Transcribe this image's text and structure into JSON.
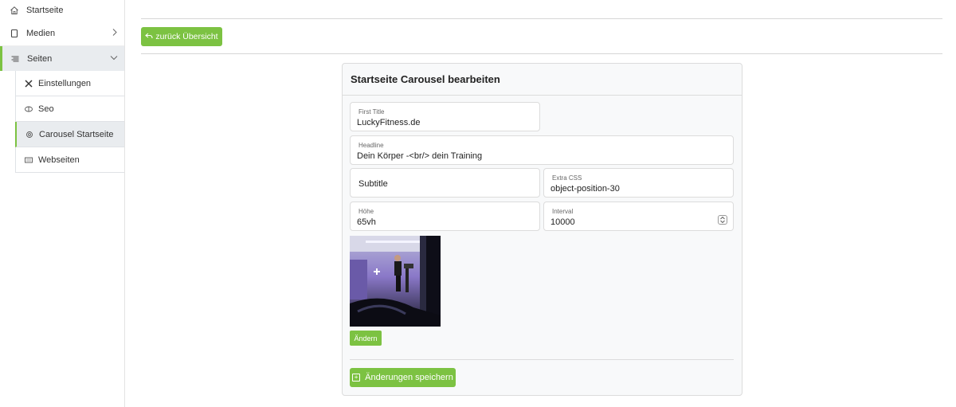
{
  "sidebar": {
    "items": [
      {
        "label": "Startseite",
        "icon": "home-icon"
      },
      {
        "label": "Medien",
        "icon": "file-icon"
      },
      {
        "label": "Seiten",
        "icon": "list-icon"
      }
    ],
    "sub_items": [
      {
        "label": "Einstellungen",
        "icon": "tools-icon"
      },
      {
        "label": "Seo",
        "icon": "seo-icon"
      },
      {
        "label": "Carousel Startseite",
        "icon": "gear-icon"
      },
      {
        "label": "Webseiten",
        "icon": "window-icon"
      }
    ]
  },
  "toolbar": {
    "back_label": "zurück Übersicht"
  },
  "card": {
    "title": "Startseite Carousel bearbeiten",
    "fields": {
      "first_title": {
        "label": "First Title",
        "value": "LuckyFitness.de"
      },
      "headline": {
        "label": "Headline",
        "value": "Dein Körper -<br/> dein Training"
      },
      "subtitle": {
        "placeholder": "Subtitle"
      },
      "extra_css": {
        "label": "Extra CSS",
        "value": "object-position-30"
      },
      "hoehe": {
        "label": "Höhe",
        "value": "65vh"
      },
      "interval": {
        "label": "Interval",
        "value": "10000"
      }
    },
    "change_label": "Ändern",
    "save_label": "Änderungen speichern"
  },
  "colors": {
    "accent": "#7cc242",
    "active_bg": "#e9ecef"
  }
}
